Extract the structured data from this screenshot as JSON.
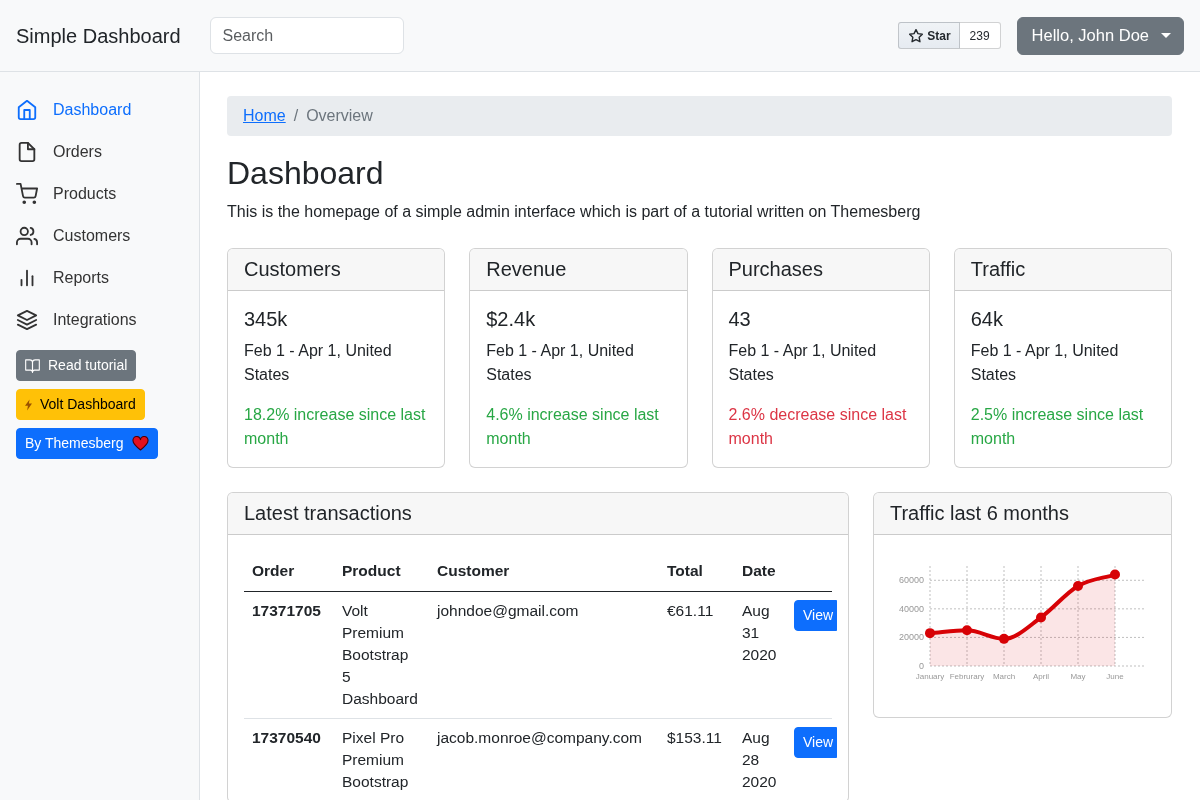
{
  "navbar": {
    "brand": "Simple Dashboard",
    "search": {
      "placeholder": "Search"
    },
    "star_button": {
      "label": "Star",
      "count": "239"
    },
    "user_menu": {
      "label": "Hello, John Doe"
    }
  },
  "sidebar": {
    "items": [
      {
        "label": "Dashboard",
        "selected": true
      },
      {
        "label": "Orders",
        "selected": false
      },
      {
        "label": "Products",
        "selected": false
      },
      {
        "label": "Customers",
        "selected": false
      },
      {
        "label": "Reports",
        "selected": false
      },
      {
        "label": "Integrations",
        "selected": false
      }
    ],
    "buttons": [
      {
        "label": "Read tutorial",
        "kind": "tutorial"
      },
      {
        "label": "Volt Dashboard",
        "kind": "promo"
      },
      {
        "label": "By Themesberg",
        "kind": "credit"
      }
    ]
  },
  "breadcrumb": {
    "separator": "/",
    "items": [
      {
        "label": "Home",
        "current": false
      },
      {
        "label": "Overview",
        "current": true
      }
    ]
  },
  "page": {
    "title": "Dashboard",
    "description": "This is the homepage of a simple admin interface which is part of a tutorial written on Themesberg"
  },
  "stat_cards": [
    {
      "title": "Customers",
      "value": "345k",
      "period": "Feb 1 - Apr 1, United States",
      "change": "18.2% increase since last month",
      "color": "#28a745"
    },
    {
      "title": "Revenue",
      "value": "$2.4k",
      "period": "Feb 1 - Apr 1, United States",
      "change": "4.6% increase since last month",
      "color": "#28a745"
    },
    {
      "title": "Purchases",
      "value": "43",
      "period": "Feb 1 - Apr 1, United States",
      "change": "2.6% decrease since last month",
      "color": "#dc3545"
    },
    {
      "title": "Traffic",
      "value": "64k",
      "period": "Feb 1 - Apr 1, United States",
      "change": "2.5% increase since last month",
      "color": "#28a745"
    }
  ],
  "transactions": {
    "title": "Latest transactions",
    "columns": [
      "Order",
      "Product",
      "Customer",
      "Total",
      "Date"
    ],
    "rows": [
      {
        "order": "17371705",
        "product": "Volt Premium Bootstrap 5 Dashboard",
        "customer": "johndoe@gmail.com",
        "total": "€61.11",
        "date": "Aug 31 2020",
        "action": "View"
      },
      {
        "order": "17370540",
        "product": "Pixel Pro Premium Bootstrap",
        "customer": "jacob.monroe@company.com",
        "total": "$153.11",
        "date": "Aug 28 2020",
        "action": "View"
      }
    ]
  },
  "traffic": {
    "title": "Traffic last 6 months",
    "chart_data": {
      "type": "area",
      "categories": [
        "January",
        "Februrary",
        "March",
        "April",
        "May",
        "June"
      ],
      "series": [
        {
          "color": "#d70206",
          "values": [
            23000,
            25000,
            19000,
            34000,
            56000,
            64000
          ]
        }
      ],
      "ylim": [
        0,
        70000
      ],
      "yticks": [
        0,
        20000,
        40000,
        60000
      ],
      "grid": true
    }
  }
}
